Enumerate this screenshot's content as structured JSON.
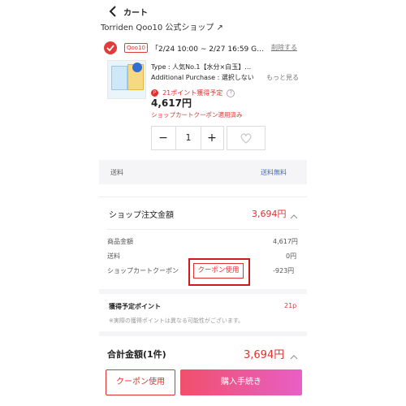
{
  "header": {
    "title": "カート",
    "back_icon": "chevron-left-icon"
  },
  "shop": {
    "name": "Torriden Qoo10 公式ショップ ↗",
    "badge": "Qoo10",
    "period": "「2/24 10:00 ~ 2/27 16:59 G…",
    "delete_label": "削除する"
  },
  "item": {
    "type_line": "Type : 人気No.1【水分×白玉】…",
    "additional_line": "Additional Purchase : 選択しない",
    "more_label": "もっと見る",
    "points_icon": "P",
    "points_text": "21ポイント獲得予定",
    "price": "4,617円",
    "coupon_note": "ショップカートクーポン適用済み",
    "quantity": "1"
  },
  "shipping": {
    "label": "送料",
    "value": "送料無料"
  },
  "shop_total": {
    "label": "ショップ注文金額",
    "amount": "3,694円",
    "rows": [
      {
        "label": "商品金額",
        "value": "4,617円"
      },
      {
        "label": "送料",
        "value": "0円"
      },
      {
        "label": "ショップカートクーポン",
        "value": "-923円",
        "button": "クーポン使用"
      }
    ]
  },
  "points": {
    "label": "獲得予定ポイント",
    "value": "21p",
    "note": "※実際の獲得ポイントは異なる可能性がございます。"
  },
  "grand_total": {
    "label": "合計金額(1件)",
    "amount": "3,694円"
  },
  "footer": {
    "coupon_button": "クーポン使用",
    "checkout_button": "購入手続き"
  },
  "colors": {
    "accent": "#e0312f",
    "link": "#2f6fd1",
    "checkout_start": "#f0506b",
    "checkout_end": "#e85fc6"
  }
}
